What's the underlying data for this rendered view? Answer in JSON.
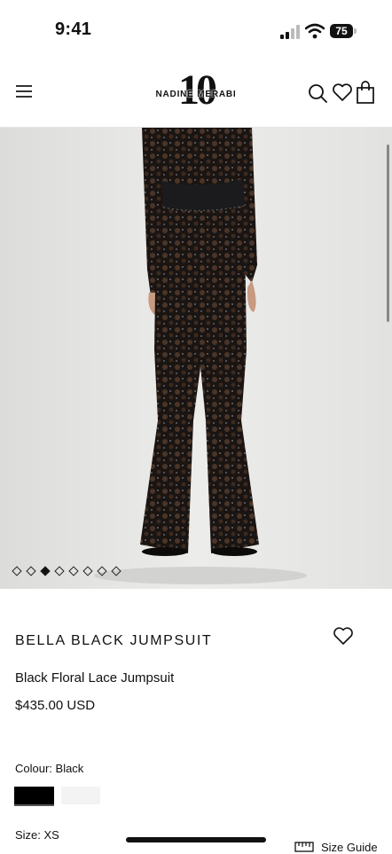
{
  "status_bar": {
    "time": "9:41",
    "battery": "75"
  },
  "header": {
    "brand_number": "10",
    "brand_name": "NADINE MERABI",
    "icons": [
      "menu-icon",
      "search-icon",
      "heart-icon",
      "bag-icon"
    ]
  },
  "gallery": {
    "slide_count": 8,
    "active_slide": 3
  },
  "product": {
    "title": "BELLA BLACK JUMPSUIT",
    "subtitle": "Black Floral Lace Jumpsuit",
    "price": "$435.00 USD",
    "colour_label": "Colour: Black",
    "swatches": [
      {
        "name": "Black",
        "color": "#000000",
        "selected": true
      },
      {
        "name": "White",
        "color": "#f3f3f3",
        "selected": false
      }
    ],
    "size_label": "Size: XS",
    "size_guide_label": "Size Guide"
  }
}
